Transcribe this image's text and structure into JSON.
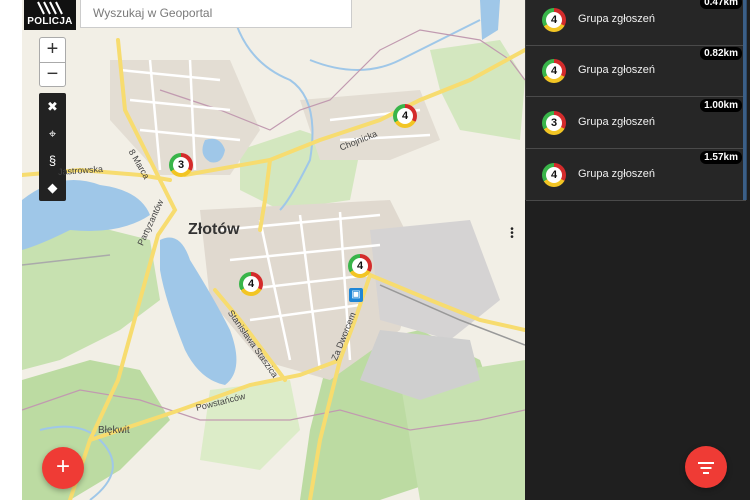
{
  "header": {
    "logo_text": "POLICJA",
    "search_placeholder": "Wyszukaj w Geoportal"
  },
  "map_controls": {
    "zoom_in": "+",
    "zoom_out": "−",
    "tools": [
      "fullscreen-icon",
      "locate-icon",
      "legal-section-icon",
      "tag-icon"
    ]
  },
  "map_labels": {
    "city": "Złotów",
    "streets": {
      "marca": "8 Marca",
      "jastrowska": "Jastrowska",
      "partyzantow": "Partyzantów",
      "chojnicka": "Chojnicka",
      "staszica": "Stanisława Staszica",
      "dworcem": "Za Dworcem",
      "powstancow": "Powstańców",
      "blekwit": "Błękwit"
    }
  },
  "map_clusters": [
    {
      "count": "3"
    },
    {
      "count": "4"
    },
    {
      "count": "4"
    },
    {
      "count": "4"
    }
  ],
  "results": [
    {
      "count": "4",
      "name": "Grupa zgłoszeń",
      "distance": "0.47km"
    },
    {
      "count": "4",
      "name": "Grupa zgłoszeń",
      "distance": "0.82km"
    },
    {
      "count": "3",
      "name": "Grupa zgłoszeń",
      "distance": "1.00km"
    },
    {
      "count": "4",
      "name": "Grupa zgłoszeń",
      "distance": "1.57km"
    }
  ],
  "fab": {
    "add_label": "+"
  },
  "colors": {
    "accent": "#ef3b35",
    "panel": "#1f1f1f",
    "rail": "#1f86d6"
  }
}
